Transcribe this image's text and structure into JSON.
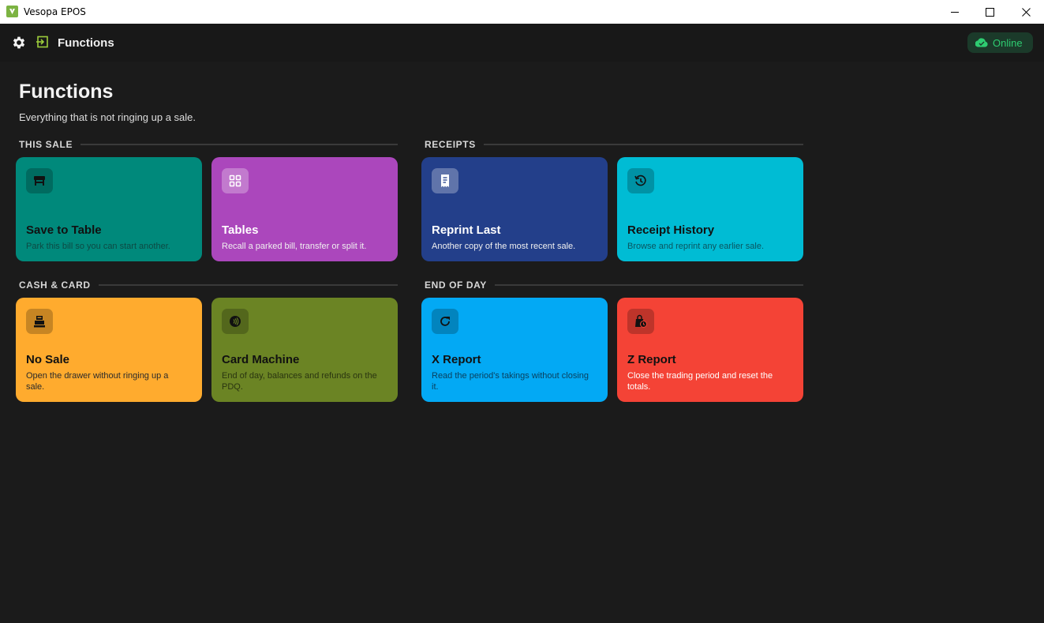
{
  "window": {
    "title": "Vesopa EPOS",
    "minimize_glyph": "—",
    "maximize_glyph": "☐",
    "close_glyph": "✕"
  },
  "header": {
    "title": "Functions",
    "status": "Online",
    "icons": [
      "gear-icon",
      "exit-icon",
      "cloud-check-icon"
    ]
  },
  "page": {
    "title": "Functions",
    "subtitle": "Everything that is not ringing up a sale."
  },
  "sections": {
    "this_sale": {
      "label": "THIS SALE",
      "cards": [
        {
          "title": "Save to Table",
          "desc": "Park this bill so you can start another.",
          "color": "#00897b",
          "icon": "table-icon"
        },
        {
          "title": "Tables",
          "desc": "Recall a parked bill, transfer or split it.",
          "color": "#ab47bc",
          "icon": "grid-icon"
        }
      ]
    },
    "receipts": {
      "label": "RECEIPTS",
      "cards": [
        {
          "title": "Reprint Last",
          "desc": "Another copy of the most recent sale.",
          "color": "#233f8a",
          "icon": "receipt-icon"
        },
        {
          "title": "Receipt History",
          "desc": "Browse and reprint any earlier sale.",
          "color": "#00bcd4",
          "icon": "history-icon"
        }
      ]
    },
    "cash_card": {
      "label": "CASH & CARD",
      "cards": [
        {
          "title": "No Sale",
          "desc": "Open the drawer without ringing up a sale.",
          "color": "#ffab2e",
          "icon": "cash-register-icon"
        },
        {
          "title": "Card Machine",
          "desc": "End of day, balances and refunds on the PDQ.",
          "color": "#6b8424",
          "icon": "contactless-icon"
        }
      ]
    },
    "end_of_day": {
      "label": "END OF DAY",
      "cards": [
        {
          "title": "X Report",
          "desc": "Read the period's takings without closing it.",
          "color": "#03a9f4",
          "icon": "refresh-icon"
        },
        {
          "title": "Z Report",
          "desc": "Close the trading period and reset the totals.",
          "color": "#f44336",
          "icon": "bag-clock-icon"
        }
      ]
    }
  }
}
